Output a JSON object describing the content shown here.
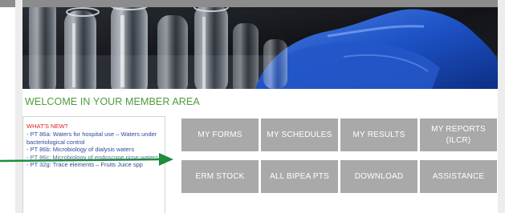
{
  "welcome": {
    "title": "WELCOME IN YOUR MEMBER AREA"
  },
  "news": {
    "title": "WHAT'S NEW?",
    "items": [
      "- PT 86a: Waters for hospital use – Waters under bacteriological control",
      "- PT 86b: Microbiology of dialysis waters",
      "- PT 86c: Microbiology of endoscope rinse waters",
      "- PT 32g: Trace elements – Fruits Juice spp"
    ]
  },
  "menu": {
    "tiles": [
      "MY FORMS",
      "MY SCHEDULES",
      "MY RESULTS",
      "MY REPORTS (ILCR)",
      "ERM STOCK",
      "ALL BIPEA PTS",
      "DOWNLOAD",
      "ASSISTANCE"
    ]
  },
  "colors": {
    "accent_green": "#4f9a3c",
    "news_title_red": "#e02020",
    "link_blue": "#2d4b9a",
    "tile_gray": "#a9a9a9",
    "arrow_green": "#1e8c3a"
  },
  "hero": {
    "image": "laboratory test tubes held by blue gloved hand"
  },
  "arrow": {
    "icon": "arrow-right-icon"
  }
}
